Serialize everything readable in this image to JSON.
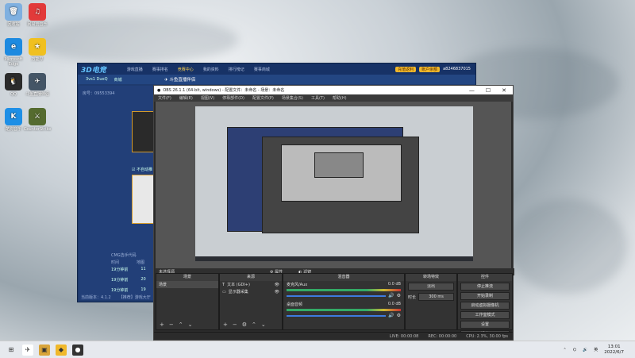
{
  "desktop": {
    "icons": [
      {
        "label": "回收站",
        "glyph": "🗑",
        "color": "#7fb0e0"
      },
      {
        "label": "网易云音乐",
        "glyph": "♫",
        "color": "#e23a3a"
      },
      {
        "label": "Microsoft Edge",
        "glyph": "e",
        "color": "#1d8ae0"
      },
      {
        "label": "万能导",
        "glyph": "★",
        "color": "#f0c020"
      },
      {
        "label": "QQ",
        "glyph": "🐧",
        "color": "#2b2b2b"
      },
      {
        "label": "斗鱼直播伴侣",
        "glyph": "✈",
        "color": "#445566"
      },
      {
        "label": "酷狗音乐",
        "glyph": "K",
        "color": "#1e8fe6"
      },
      {
        "label": "CounterStrike",
        "glyph": "⚔",
        "color": "#556b2f"
      }
    ]
  },
  "left_app": {
    "logo": "3D电竞",
    "nav": [
      "游戏直播",
      "赛事排名",
      "竞赛中心",
      "我的资料",
      "排行榜记",
      "赛事商城"
    ],
    "active_nav_index": 2,
    "sub_tabs": [
      "3vs1 DuoQ",
      "商城"
    ],
    "room_label": "房号：09553394",
    "checkbox_label": "不自动推",
    "side_label": "CMG选手代码",
    "table_header": [
      "时间",
      "地图"
    ],
    "table_rows": [
      [
        "19分钟前",
        "11"
      ],
      [
        "19分钟前",
        "20"
      ],
      [
        "19分钟前",
        "19"
      ]
    ],
    "status": "当前版本：4.1.2",
    "status2": "【推荐】游戏大厅",
    "gold_buttons": [
      "充值返利",
      "账户余额"
    ],
    "user_id": "a8246837015"
  },
  "douyu_title": "斗鱼直播伴侣",
  "obs": {
    "title": "OBS 26.1.1 (64-bit, windows) - 配置文件：未命名 - 场景：未命名",
    "menu": [
      "文件(F)",
      "编辑(E)",
      "视图(V)",
      "停靠部件(D)",
      "配置文件(P)",
      "场景集合(S)",
      "工具(T)",
      "帮助(H)"
    ],
    "no_source": "未选择源",
    "props_btn": "属性",
    "filter_btn": "滤镜",
    "docks": {
      "scenes": {
        "title": "场景",
        "items": [
          "场景"
        ]
      },
      "sources": {
        "title": "来源",
        "items": [
          "文本 (GDI+)",
          "显示器采集"
        ]
      },
      "mixer": {
        "title": "混音器",
        "channels": [
          {
            "name": "麦克风/Aux",
            "db": "0.0 dB"
          },
          {
            "name": "桌面音频",
            "db": "0.0 dB"
          }
        ]
      },
      "transitions": {
        "title": "转场特效",
        "mode": "淡出",
        "duration_label": "时长",
        "duration": "300 ms"
      },
      "controls": {
        "title": "控件",
        "buttons": [
          "停止推流",
          "开始录制",
          "启动虚拟摄像机",
          "工作室模式",
          "设置",
          "退出"
        ]
      }
    },
    "status": [
      "LIVE: 00:00:08",
      "REC: 00:00:00",
      "CPU: 2.3%, 30.00 fps"
    ]
  },
  "taskbar": {
    "time": "13:01",
    "date": "2022/6/7"
  }
}
